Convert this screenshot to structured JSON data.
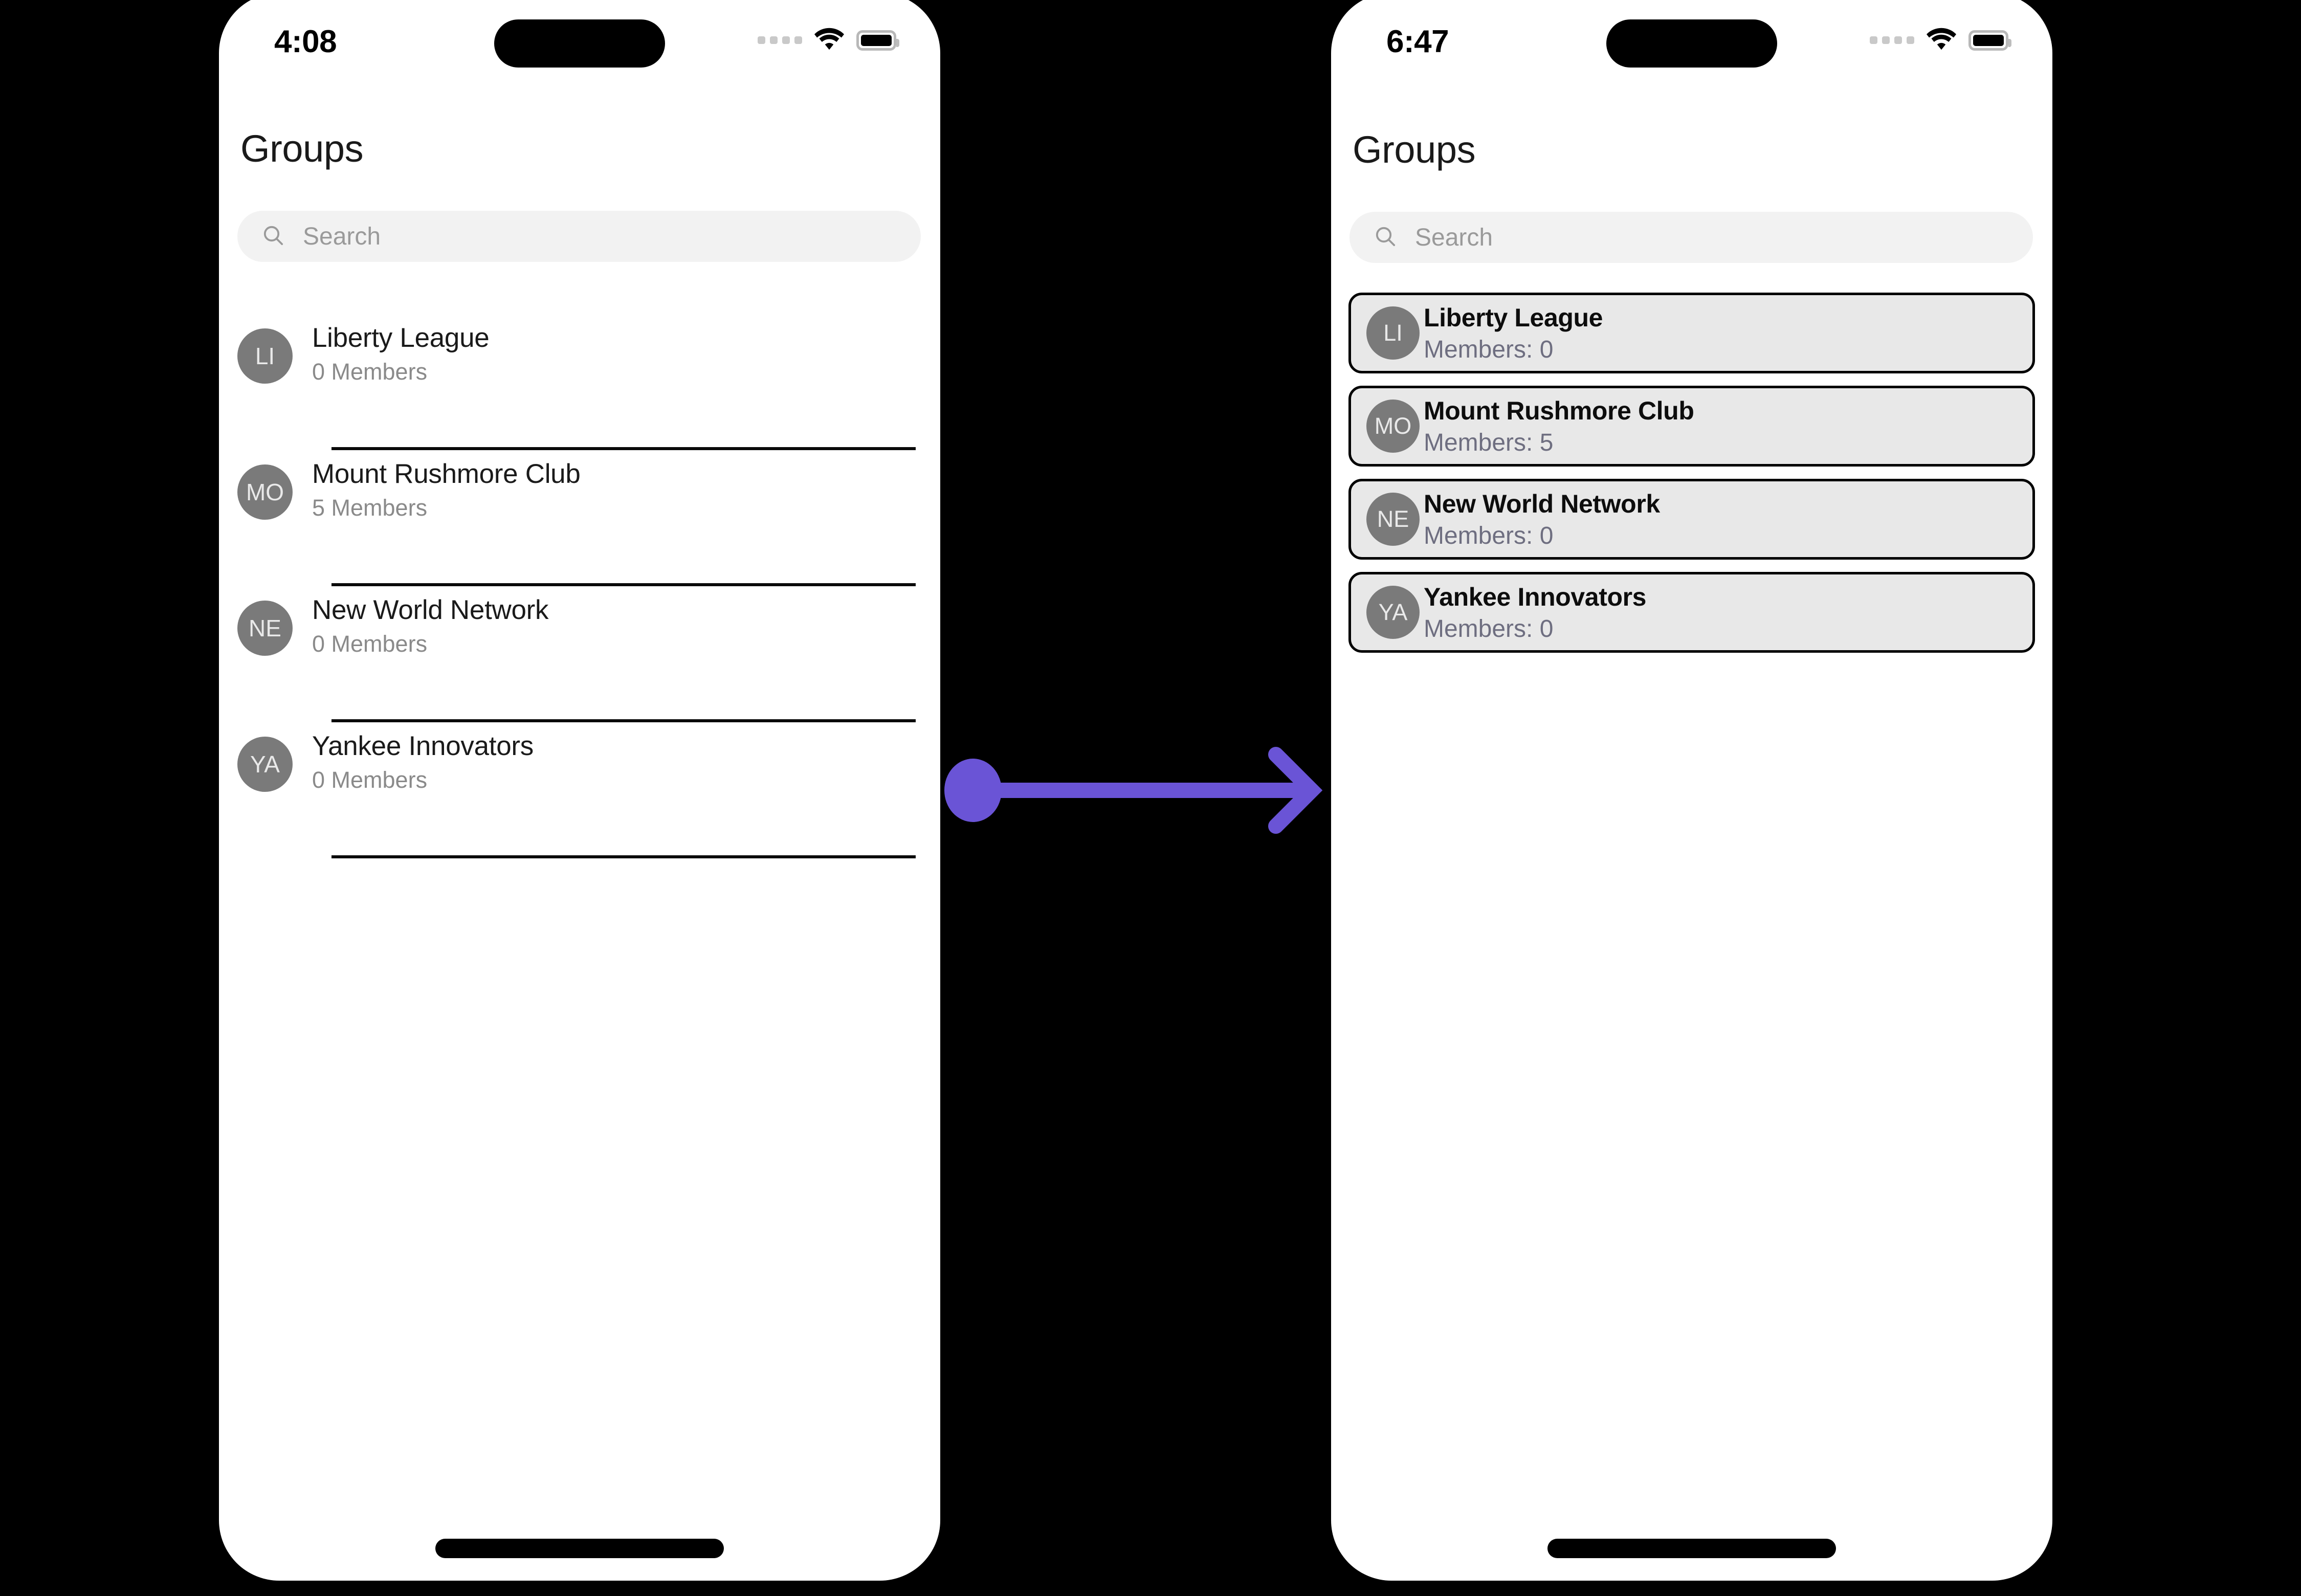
{
  "canvas": {
    "background": "#000000",
    "accent": "#6A54D6"
  },
  "arrow": {
    "name": "transition-arrow",
    "color": "#6A54D6",
    "direction": "right"
  },
  "phones": [
    {
      "id": "before",
      "status": {
        "time": "4:08",
        "cellular": "cellular-dots",
        "wifi": "wifi-icon",
        "battery": "battery-icon"
      },
      "title": "Groups",
      "search": {
        "placeholder": "Search",
        "icon": "search-icon"
      },
      "style": "plain-list",
      "groups": [
        {
          "initials": "LI",
          "name": "Liberty League",
          "members_label": "0 Members",
          "members": 0
        },
        {
          "initials": "MO",
          "name": "Mount Rushmore Club",
          "members_label": "5 Members",
          "members": 5
        },
        {
          "initials": "NE",
          "name": "New World Network",
          "members_label": "0 Members",
          "members": 0
        },
        {
          "initials": "YA",
          "name": "Yankee Innovators",
          "members_label": "0 Members",
          "members": 0
        }
      ]
    },
    {
      "id": "after",
      "status": {
        "time": "6:47",
        "cellular": "cellular-dots",
        "wifi": "wifi-icon",
        "battery": "battery-icon"
      },
      "title": "Groups",
      "search": {
        "placeholder": "Search",
        "icon": "search-icon"
      },
      "style": "card-list",
      "groups": [
        {
          "initials": "LI",
          "name": "Liberty League",
          "members_label": "Members: 0",
          "members": 0
        },
        {
          "initials": "MO",
          "name": "Mount Rushmore Club",
          "members_label": "Members: 5",
          "members": 5
        },
        {
          "initials": "NE",
          "name": "New World Network",
          "members_label": "Members: 0",
          "members": 0
        },
        {
          "initials": "YA",
          "name": "Yankee Innovators",
          "members_label": "Members: 0",
          "members": 0
        }
      ]
    }
  ]
}
